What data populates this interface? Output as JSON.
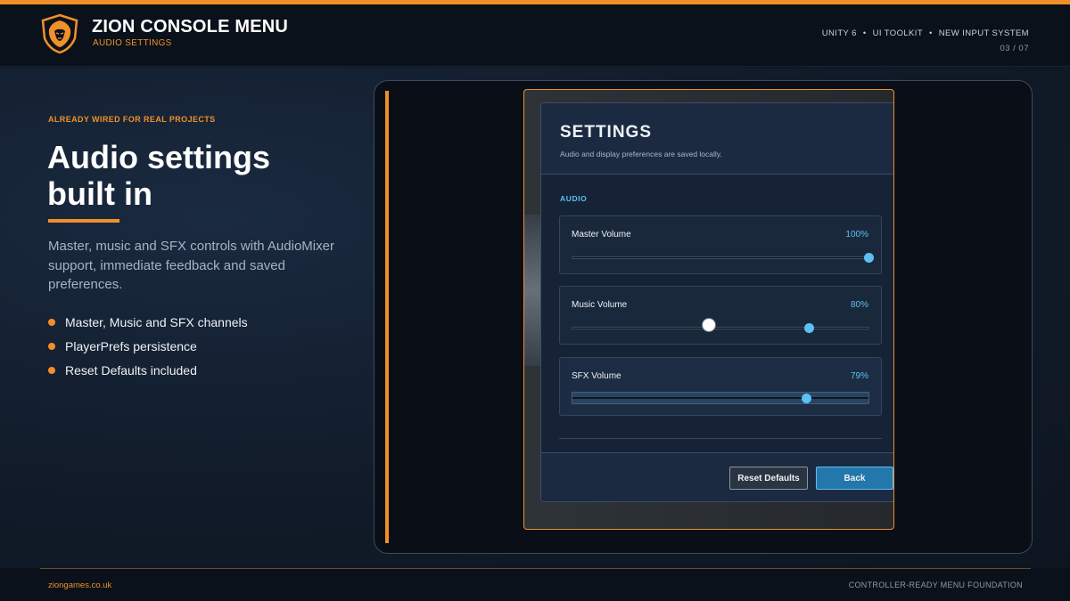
{
  "header": {
    "title": "ZION CONSOLE MENU",
    "subtitle": "AUDIO SETTINGS",
    "tech": [
      "UNITY 6",
      "UI TOOLKIT",
      "NEW INPUT SYSTEM"
    ],
    "page_count": "03 / 07",
    "logo_icon": "lion-shield-icon"
  },
  "intro": {
    "eyebrow": "ALREADY WIRED FOR REAL PROJECTS",
    "headline": "Audio settings built in",
    "description": "Master, music and SFX controls with AudioMixer support, immediate feedback and saved preferences.",
    "bullets": [
      "Master, Music and SFX channels",
      "PlayerPrefs persistence",
      "Reset Defaults included"
    ]
  },
  "settings": {
    "title": "SETTINGS",
    "subtitle": "Audio and display preferences are saved locally.",
    "section": "AUDIO",
    "rows": [
      {
        "label": "Master Volume",
        "value_text": "100%",
        "level": 1.0
      },
      {
        "label": "Music Volume",
        "value_text": "80%",
        "level": 0.8
      },
      {
        "label": "SFX Volume",
        "value_text": "79%",
        "level": 0.79
      }
    ],
    "reset_label": "Reset Defaults",
    "back_label": "Back",
    "focused_row": "SFX Volume"
  },
  "footer": {
    "site": "ziongames.co.uk",
    "tagline": "CONTROLLER-READY MENU FOUNDATION"
  },
  "colors": {
    "accent": "#f0902a",
    "highlight": "#5cc0f2",
    "button_primary": "#2477aa"
  }
}
